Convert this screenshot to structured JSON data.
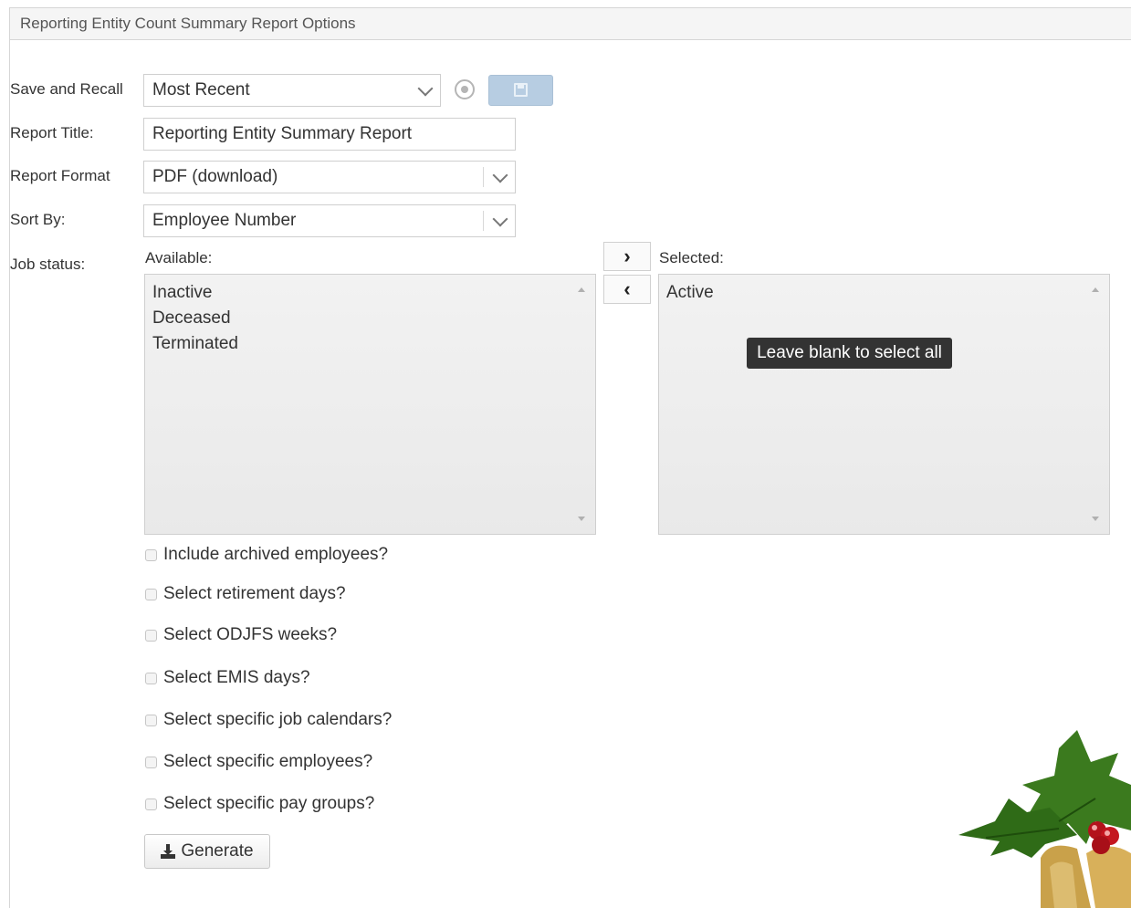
{
  "panel": {
    "title": "Reporting Entity Count Summary Report Options"
  },
  "form": {
    "save_recall": {
      "label": "Save and Recall",
      "value": "Most Recent"
    },
    "report_title": {
      "label": "Report Title:",
      "value": "Reporting Entity Summary Report"
    },
    "report_format": {
      "label": "Report Format",
      "value": "PDF (download)"
    },
    "sort_by": {
      "label": "Sort By:",
      "value": "Employee Number"
    },
    "job_status": {
      "label": "Job status:",
      "available_label": "Available:",
      "selected_label": "Selected:",
      "available_items": [
        "Inactive",
        "Deceased",
        "Terminated"
      ],
      "selected_items": [
        "Active"
      ],
      "move_right": "›",
      "move_left": "‹",
      "tooltip": "Leave blank to select all"
    },
    "checkboxes": [
      {
        "label": "Include archived employees?",
        "checked": false
      },
      {
        "label": "Select retirement days?",
        "checked": false
      },
      {
        "label": "Select ODJFS weeks?",
        "checked": false
      },
      {
        "label": "Select EMIS days?",
        "checked": false
      },
      {
        "label": "Select specific job calendars?",
        "checked": false
      },
      {
        "label": "Select specific employees?",
        "checked": false
      },
      {
        "label": "Select specific pay groups?",
        "checked": false
      }
    ],
    "generate_label": "Generate"
  },
  "icons": {
    "clear": "clear-icon",
    "save": "floppy-disk-icon",
    "download": "download-icon",
    "decoration": "holly-bells-decoration"
  },
  "colors": {
    "save_button": "#b7cde2",
    "tooltip_bg": "#333333"
  }
}
